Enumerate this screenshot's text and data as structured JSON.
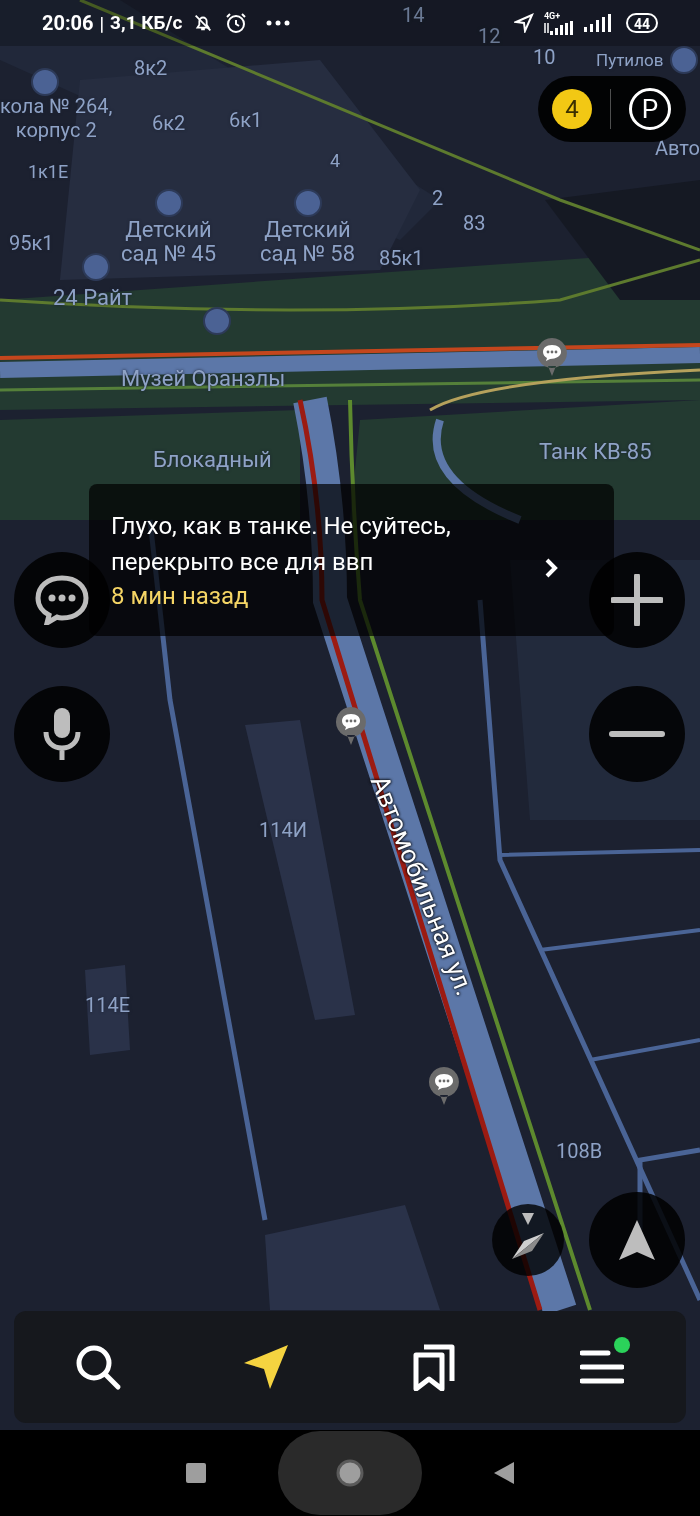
{
  "status_bar": {
    "time": "20:06",
    "separator": "|",
    "speed": "3,1 КБ/с",
    "network": "4G+",
    "battery": "44"
  },
  "map": {
    "labels": [
      {
        "text": "14"
      },
      {
        "text": "12"
      },
      {
        "text": "10"
      },
      {
        "text": "Путилов"
      },
      {
        "text": "Авто"
      },
      {
        "text": "8к2"
      },
      {
        "text": "кола № 264,\nкорпус 2"
      },
      {
        "text": "6к2"
      },
      {
        "text": "6к1"
      },
      {
        "text": "4"
      },
      {
        "text": "1к1Е"
      },
      {
        "text": "2"
      },
      {
        "text": "83"
      },
      {
        "text": "Детский\nсад № 45"
      },
      {
        "text": "Детский\nсад № 58"
      },
      {
        "text": "85к1"
      },
      {
        "text": "95к1"
      },
      {
        "text": "24 Райт"
      },
      {
        "text": "Музей Оранэлы"
      },
      {
        "text": "Блокадный"
      },
      {
        "text": "Танк КВ-85"
      },
      {
        "text": "114И"
      },
      {
        "text": "114Е"
      },
      {
        "text": "108В"
      }
    ],
    "street_label": "Автомобильная ул."
  },
  "map_badges": {
    "traffic_level": "4",
    "parking": "P"
  },
  "notification": {
    "message": "Глухо, как в танке. Не суйтесь, перекрыто все для ввп",
    "time": "8 мин назад"
  },
  "bottom_nav": [
    {
      "kind": "search",
      "selected": false,
      "dot": false
    },
    {
      "kind": "navigator",
      "selected": true,
      "dot": false
    },
    {
      "kind": "bookmarks",
      "selected": false,
      "dot": false
    },
    {
      "kind": "menu",
      "selected": false,
      "dot": true
    }
  ]
}
